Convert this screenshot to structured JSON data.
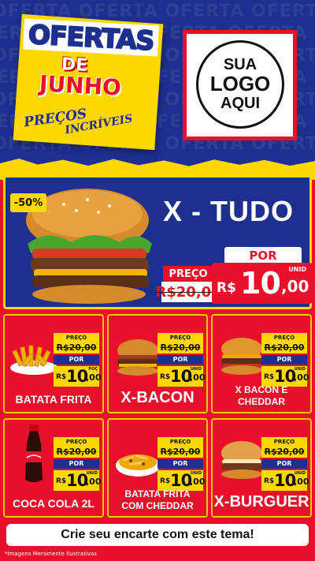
{
  "header": {
    "watermark_text": "OFERTA OFERTA OFERTA OFERTA OFERTA",
    "title_ofertas": "OFERTAS",
    "title_de": "DE",
    "title_junho": "JUNHO",
    "title_precos": "PREÇOS",
    "title_incriveis": "INCRÍVEIS",
    "logo_line1": "SUA",
    "logo_line2": "LOGO",
    "logo_line3": "AQUI"
  },
  "hero": {
    "discount": "-50%",
    "name": "X - TUDO",
    "por_label": "POR",
    "preco_label": "PREÇO",
    "old_price": "R$20,00",
    "unid_label": "UNID",
    "currency": "R$",
    "price_whole": "10",
    "price_cents": ",00"
  },
  "products": [
    {
      "name": "BATATA FRITA",
      "preco_label": "PREÇO",
      "old_price": "R$20,00",
      "por_label": "POR",
      "currency": "R$",
      "price_whole": "10",
      "price_cents": ",00",
      "unit": "POÇ"
    },
    {
      "name": "X-BACON",
      "preco_label": "PREÇO",
      "old_price": "R$20,00",
      "por_label": "POR",
      "currency": "R$",
      "price_whole": "10",
      "price_cents": ",00",
      "unit": "UNID"
    },
    {
      "name_line1": "X BACON E",
      "name_line2": "CHEDDAR",
      "preco_label": "PREÇO",
      "old_price": "R$20,00",
      "por_label": "POR",
      "currency": "R$",
      "price_whole": "10",
      "price_cents": ",00",
      "unit": "UNID"
    },
    {
      "name": "COCA COLA 2L",
      "preco_label": "PREÇO",
      "old_price": "R$20,00",
      "por_label": "POR",
      "currency": "R$",
      "price_whole": "10",
      "price_cents": ",00",
      "unit": "UNID"
    },
    {
      "name_line1": "BATATA FRITA",
      "name_line2": "COM CHEDDAR",
      "preco_label": "PREÇO",
      "old_price": "R$20,00",
      "por_label": "POR",
      "currency": "R$",
      "price_whole": "10",
      "price_cents": ",00",
      "unit": "UNID"
    },
    {
      "name": "X-BURGUER",
      "preco_label": "PREÇO",
      "old_price": "R$20,00",
      "por_label": "POR",
      "currency": "R$",
      "price_whole": "10",
      "price_cents": ",00",
      "unit": "UNID"
    }
  ],
  "footer": {
    "cta": "Crie seu encarte com este tema!",
    "disclaimer": "*Imagens Meramente Ilustrativas"
  },
  "colors": {
    "blue": "#1d2f8f",
    "red": "#e8102a",
    "yellow": "#ffd800"
  }
}
